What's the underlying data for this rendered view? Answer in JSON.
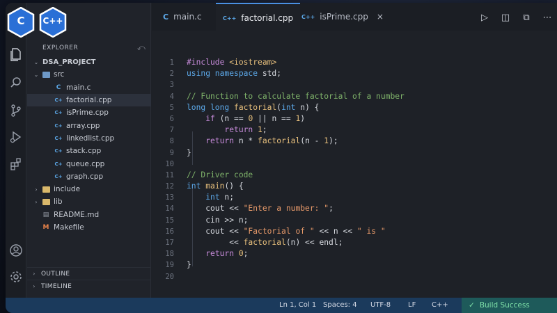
{
  "logos": [
    {
      "icon": "c-logo-icon",
      "text": "C",
      "color": "#2a6fd6"
    },
    {
      "icon": "cpp-logo-icon",
      "text": "C++",
      "color": "#2a6fd6"
    }
  ],
  "activity_bar": [
    "files-icon",
    "search-icon",
    "source-control-icon",
    "run-debug-icon",
    "extensions-icon",
    "account-icon",
    "settings-icon"
  ],
  "explorer": {
    "title": "EXPLORER",
    "project": "DSA_PROJECT",
    "items": [
      {
        "label": "src",
        "type": "folder",
        "level": 1,
        "open": true
      },
      {
        "label": "main.c",
        "type": "c",
        "level": 2
      },
      {
        "label": "factorial.cpp",
        "type": "cpp",
        "level": 2,
        "active": true
      },
      {
        "label": "isPrime.cpp",
        "type": "cpp",
        "level": 2
      },
      {
        "label": "array.cpp",
        "type": "cpp",
        "level": 2
      },
      {
        "label": "linkedlist.cpp",
        "type": "cpp",
        "level": 2
      },
      {
        "label": "stack.cpp",
        "type": "cpp",
        "level": 2
      },
      {
        "label": "queue.cpp",
        "type": "cpp",
        "level": 2
      },
      {
        "label": "graph.cpp",
        "type": "cpp",
        "level": 2
      },
      {
        "label": "include",
        "type": "folder",
        "level": 1
      },
      {
        "label": "lib",
        "type": "folder",
        "level": 1
      },
      {
        "label": "README.md",
        "type": "md",
        "level": 1
      },
      {
        "label": "Makefile",
        "type": "make",
        "level": 1
      }
    ],
    "outline": "OUTLINE",
    "timeline": "TIMELINE"
  },
  "tabs": [
    {
      "label": "main.c",
      "icon": "C"
    },
    {
      "label": "factorial.cpp",
      "icon": "C++",
      "active": true
    },
    {
      "label": "isPrime.cpp",
      "icon": "C++",
      "close": "×"
    }
  ],
  "editor": {
    "line_numbers": [
      "1",
      "2",
      "3",
      "4",
      "5",
      "6",
      "7",
      "8",
      "9",
      "10",
      "11",
      "12",
      "13",
      "14",
      "15",
      "16",
      "17",
      "18",
      "19",
      "20"
    ]
  },
  "statusbar": {
    "position": "Ln 1, Col 1",
    "spaces": "Spaces: 4",
    "encoding": "UTF-8",
    "eol": "LF",
    "language": "C++",
    "build": "Build Success"
  },
  "colors": {
    "accent": "#4a90e2",
    "build_success": "#7ee0a8",
    "statusbar": "#1b3a5c"
  }
}
